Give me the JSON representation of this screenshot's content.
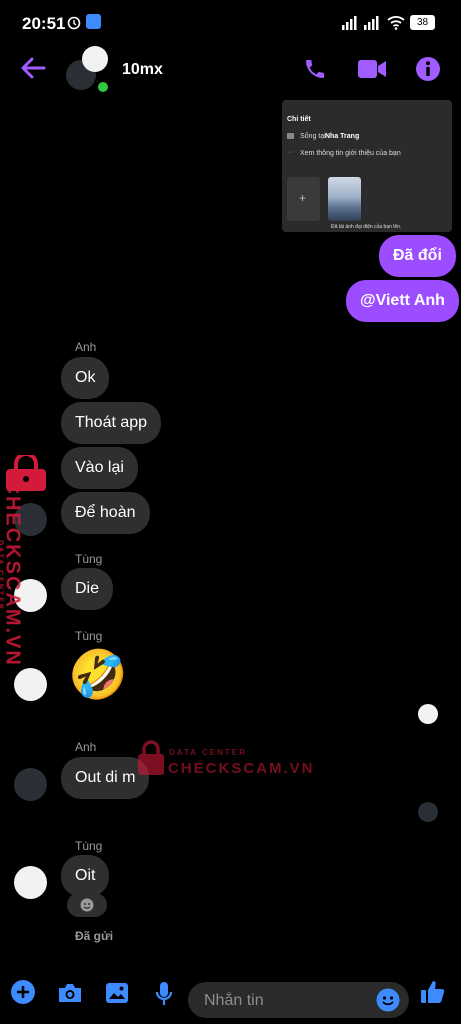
{
  "status_bar": {
    "time": "20:51",
    "battery": "38"
  },
  "header": {
    "contact_name": "10mx"
  },
  "shared_card": {
    "title": "Chi tiết",
    "lives_prefix": "Sống tại",
    "lives_place": "Nha Trang",
    "see_intro": "Xem thông tin giới thiệu của bạn",
    "add_symbol": "+",
    "photo_caption": "Đã tải ảnh đại diện của bạn lên."
  },
  "messages": {
    "out_1": "Đã đổi",
    "out_2": "@Viett Anh",
    "sender_anh_1": "Anh",
    "in_ok": "Ok",
    "in_thoat": "Thoát app",
    "in_vaolai": "Vào lại",
    "in_dehoan": "Để hoàn",
    "sender_tung_1": "Tùng",
    "in_die": "Die",
    "sender_tung_2": "Tùng",
    "emoji_laugh": "🤣",
    "sender_anh_2": "Anh",
    "in_out": "Out di m",
    "sender_tung_3": "Tùng",
    "in_oit": "Oit",
    "status_sent": "Đã gửi"
  },
  "composer": {
    "placeholder": "Nhắn tin"
  },
  "watermark": {
    "top": "DATA CENTER",
    "brand": "CHECKSCAM.VN"
  },
  "colors": {
    "accent": "#9b4dff",
    "blue": "#3d8bff",
    "incoming": "#2f2f2f"
  }
}
